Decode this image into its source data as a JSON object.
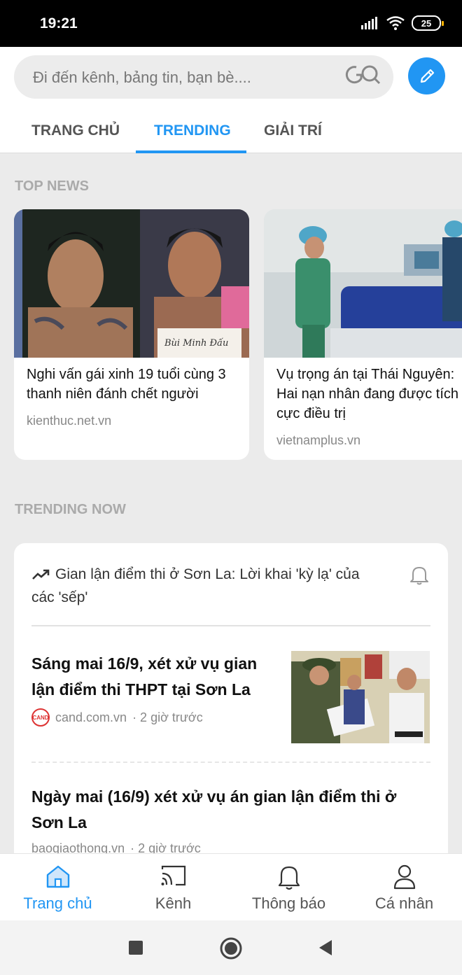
{
  "status_bar": {
    "time": "19:21",
    "battery": "25"
  },
  "search": {
    "placeholder": "Đi đến kênh, bảng tin, bạn bè....",
    "go_label": "GO"
  },
  "tabs": [
    {
      "label": "TRANG CHỦ"
    },
    {
      "label": "TRENDING"
    },
    {
      "label": "GIẢI TRÍ"
    }
  ],
  "top_news": {
    "title": "TOP NEWS",
    "items": [
      {
        "title": "Nghi vấn gái xinh 19 tuổi cùng 3 thanh niên đánh chết người",
        "source": "kienthuc.net.vn"
      },
      {
        "title": "Vụ trọng án tại Thái Nguyên: Hai nạn nhân đang được tích cực điều trị",
        "source": "vietnamplus.vn"
      }
    ]
  },
  "trending_now": {
    "title": "TRENDING NOW",
    "headline": "Gian lận điểm thi ở Sơn La: Lời khai 'kỳ lạ' của các 'sếp'",
    "articles": [
      {
        "title": "Sáng mai 16/9, xét xử vụ gian lận điểm thi THPT tại Sơn La",
        "source": "cand.com.vn",
        "time": "· 2 giờ trước",
        "logo_text": "CAND"
      },
      {
        "title": "Ngày mai (16/9) xét xử vụ án gian lận điểm thi ở Sơn La",
        "source": "baogiaothong.vn",
        "time": "· 2 giờ trước"
      }
    ]
  },
  "bottom_nav": [
    {
      "label": "Trang chủ",
      "icon": "home-icon"
    },
    {
      "label": "Kênh",
      "icon": "cast-icon"
    },
    {
      "label": "Thông báo",
      "icon": "bell-icon"
    },
    {
      "label": "Cá nhân",
      "icon": "person-icon"
    }
  ],
  "colors": {
    "accent": "#2196f3"
  }
}
